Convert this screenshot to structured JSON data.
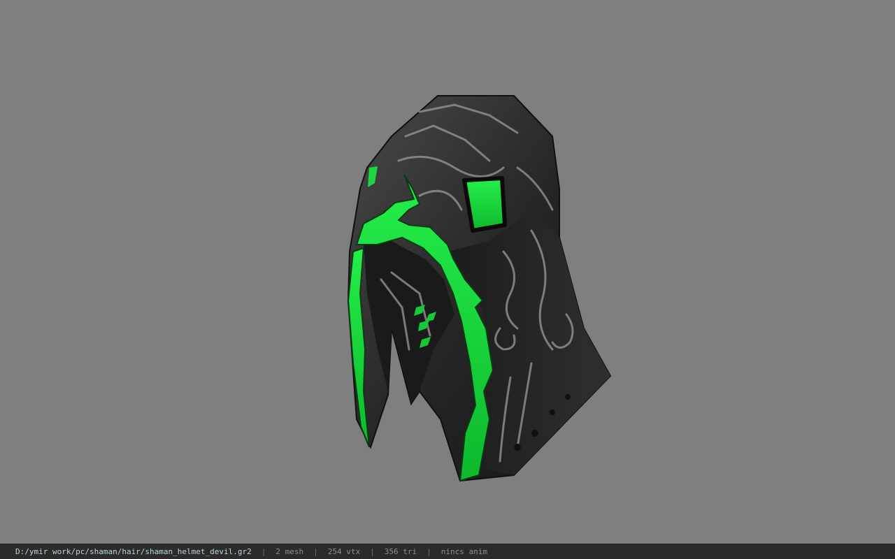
{
  "viewer": {
    "background_color": "#7f7f7f"
  },
  "model": {
    "icon": "helmet-model",
    "base_color": "#2a2a2a",
    "emissive_color": "#19e03a"
  },
  "statusbar": {
    "file_path": "D:/ymir work/pc/shaman/hair/shaman_helmet_devil.gr2",
    "mesh_count": "2 mesh",
    "vertex_count": "254 vtx",
    "triangle_count": "356 tri",
    "animation": "nincs anim",
    "separator": "|"
  }
}
